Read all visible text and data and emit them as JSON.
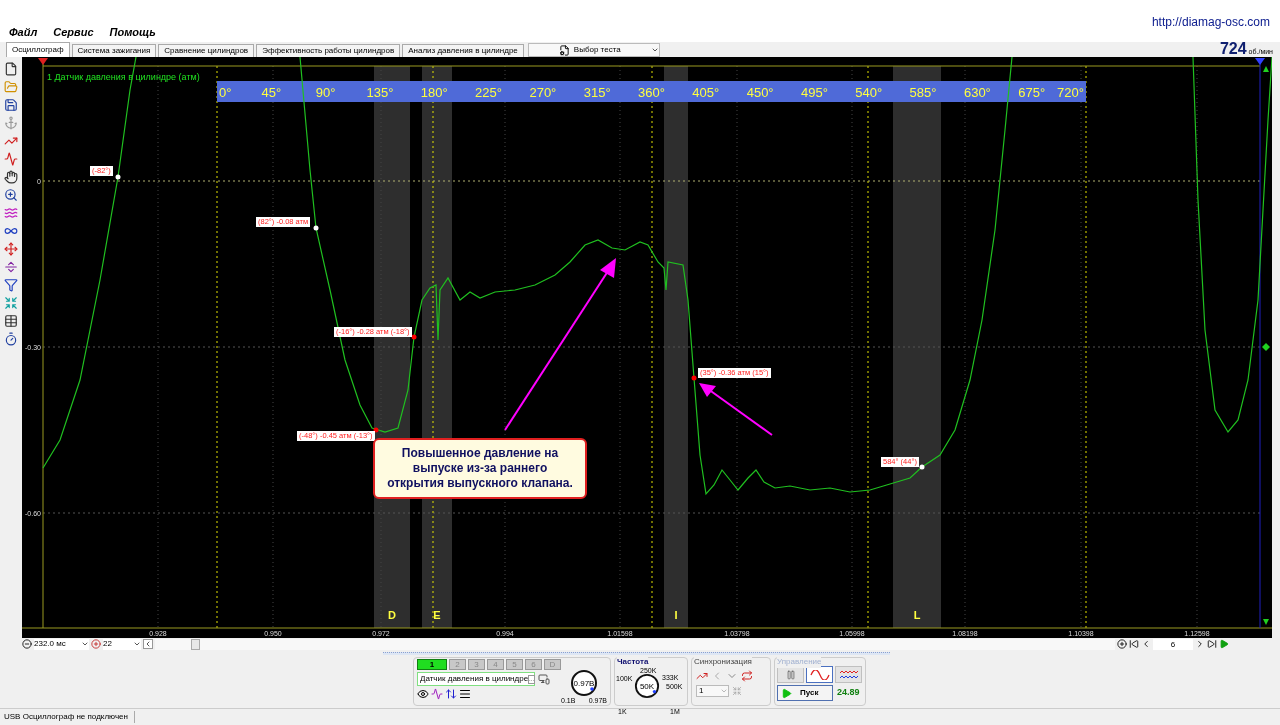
{
  "menu": [
    {
      "label": "Файл"
    },
    {
      "label": "Сервис"
    },
    {
      "label": "Помощь"
    }
  ],
  "site_link": "http://diamag-osc.com",
  "tabs": [
    {
      "label": "Осциллограф",
      "selected": true
    },
    {
      "label": "Система зажигания",
      "selected": false
    },
    {
      "label": "Сравнение цилиндров",
      "selected": false
    },
    {
      "label": "Эффективность работы цилиндров",
      "selected": false
    },
    {
      "label": "Анализ давления в цилиндре",
      "selected": false
    }
  ],
  "test_select": {
    "value": "Выбор теста"
  },
  "rpm": {
    "value": "724",
    "unit": "об./мин"
  },
  "plot": {
    "channel_title": "1 Датчик давления в цилиндре (атм)",
    "angle_labels": [
      "0°",
      "45°",
      "90°",
      "135°",
      "180°",
      "225°",
      "270°",
      "315°",
      "360°",
      "405°",
      "450°",
      "495°",
      "540°",
      "585°",
      "630°",
      "675°",
      "720°"
    ],
    "y_labels": [
      "0",
      "-0.30",
      "-0.60"
    ],
    "x_labels": [
      "0.928",
      "0.950",
      "0.972",
      "0.994",
      "1.01598",
      "1.03798",
      "1.05998",
      "1.08198",
      "1.10398",
      "1.12598"
    ],
    "phase_bands": [
      {
        "label": "D"
      },
      {
        "label": "E"
      },
      {
        "label": "I"
      },
      {
        "label": "L"
      }
    ],
    "markers": [
      {
        "text": "(-82°)",
        "color": "#ffffff"
      },
      {
        "text": "(82°) -0.08 атм",
        "color": "#ffffff"
      },
      {
        "text": "(-16°) -0.28 атм (-18°)",
        "color": "#ff0000"
      },
      {
        "text": "(-48°) -0.45 атм (-13°)",
        "color": "#ff0000"
      },
      {
        "text": "(35°) -0.36 атм (15°)",
        "color": "#ff0000"
      },
      {
        "text": "584° (44°)",
        "color": "#ffffff"
      }
    ],
    "callout": "Повышенное давление на выпуске из-за раннего открытия выпускного клапана."
  },
  "scroll_bar": {
    "time_scale": "232.0 мс",
    "zoom": "22",
    "page": "6"
  },
  "channel_panel": {
    "tabs": [
      {
        "label": "1",
        "selected": true
      },
      {
        "label": "2",
        "selected": false
      },
      {
        "label": "3",
        "selected": false
      },
      {
        "label": "4",
        "selected": false
      },
      {
        "label": "5",
        "selected": false
      },
      {
        "label": "6",
        "selected": false
      },
      {
        "label": "D",
        "selected": false
      }
    ],
    "sensor": "Датчик давления в цилиндре",
    "more_button": "...",
    "knob": {
      "value": "0.97В",
      "min": "0.1В",
      "max": "0.97В"
    }
  },
  "frequency": {
    "title": "Частота",
    "value": "50K",
    "scale": [
      "100K",
      "250K",
      "333K",
      "500K",
      "1K",
      "1M"
    ]
  },
  "sync": {
    "title": "Синхронизация",
    "channel": "1"
  },
  "control": {
    "title": "Управление",
    "start": "Пуск",
    "reading": "24.89",
    "modes": [
      {
        "kind": "pause",
        "selected": false
      },
      {
        "kind": "sine",
        "selected": true
      },
      {
        "kind": "dual",
        "selected": false
      }
    ]
  },
  "status": "USB Осциллограф не подключен"
}
